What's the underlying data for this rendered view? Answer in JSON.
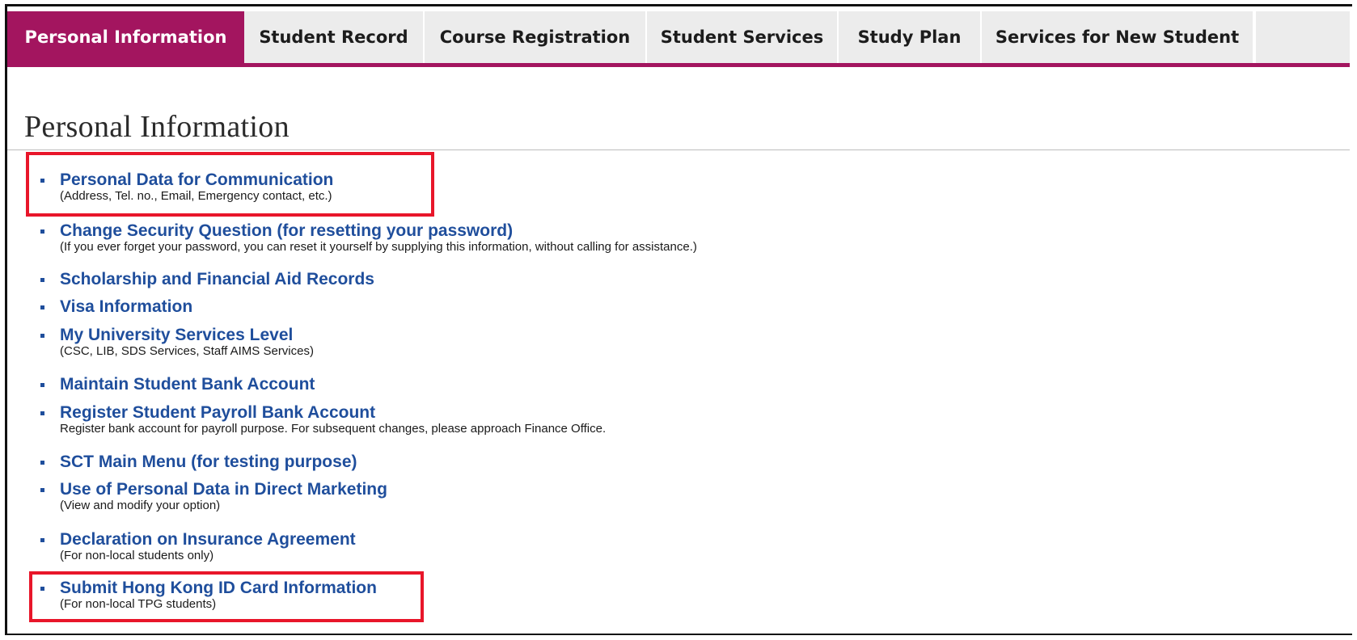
{
  "tabs": [
    {
      "label": "Personal Information",
      "active": true
    },
    {
      "label": "Student Record",
      "active": false
    },
    {
      "label": "Course Registration",
      "active": false
    },
    {
      "label": "Student Services",
      "active": false
    },
    {
      "label": "Study Plan",
      "active": false
    },
    {
      "label": "Services for New Student",
      "active": false
    }
  ],
  "page": {
    "title": "Personal Information"
  },
  "menu": {
    "items": [
      {
        "label": "Personal Data for Communication",
        "description": "(Address, Tel. no., Email, Emergency contact, etc.)"
      },
      {
        "label": "Change Security Question (for resetting your password)",
        "description": "(If you ever forget your password, you can reset it yourself by supplying this information, without calling for assistance.)"
      },
      {
        "label": "Scholarship and Financial Aid Records",
        "description": ""
      },
      {
        "label": "Visa Information",
        "description": ""
      },
      {
        "label": "My University Services Level",
        "description": "(CSC, LIB, SDS Services, Staff AIMS Services)"
      },
      {
        "label": "Maintain Student Bank Account",
        "description": ""
      },
      {
        "label": "Register Student Payroll Bank Account",
        "description": "Register bank account for payroll purpose. For subsequent changes, please approach Finance Office."
      },
      {
        "label": "SCT Main Menu (for testing purpose)",
        "description": ""
      },
      {
        "label": "Use of Personal Data in Direct Marketing",
        "description": "(View and modify your option)"
      },
      {
        "label": "Declaration on Insurance Agreement",
        "description": "(For non-local students only)"
      },
      {
        "label": "Submit Hong Kong ID Card Information",
        "description": "(For non-local TPG students)"
      }
    ]
  },
  "colors": {
    "accent": "#a3155f",
    "link": "#1f4e9c",
    "highlight": "#e8162a",
    "tab_background": "#ececec"
  }
}
